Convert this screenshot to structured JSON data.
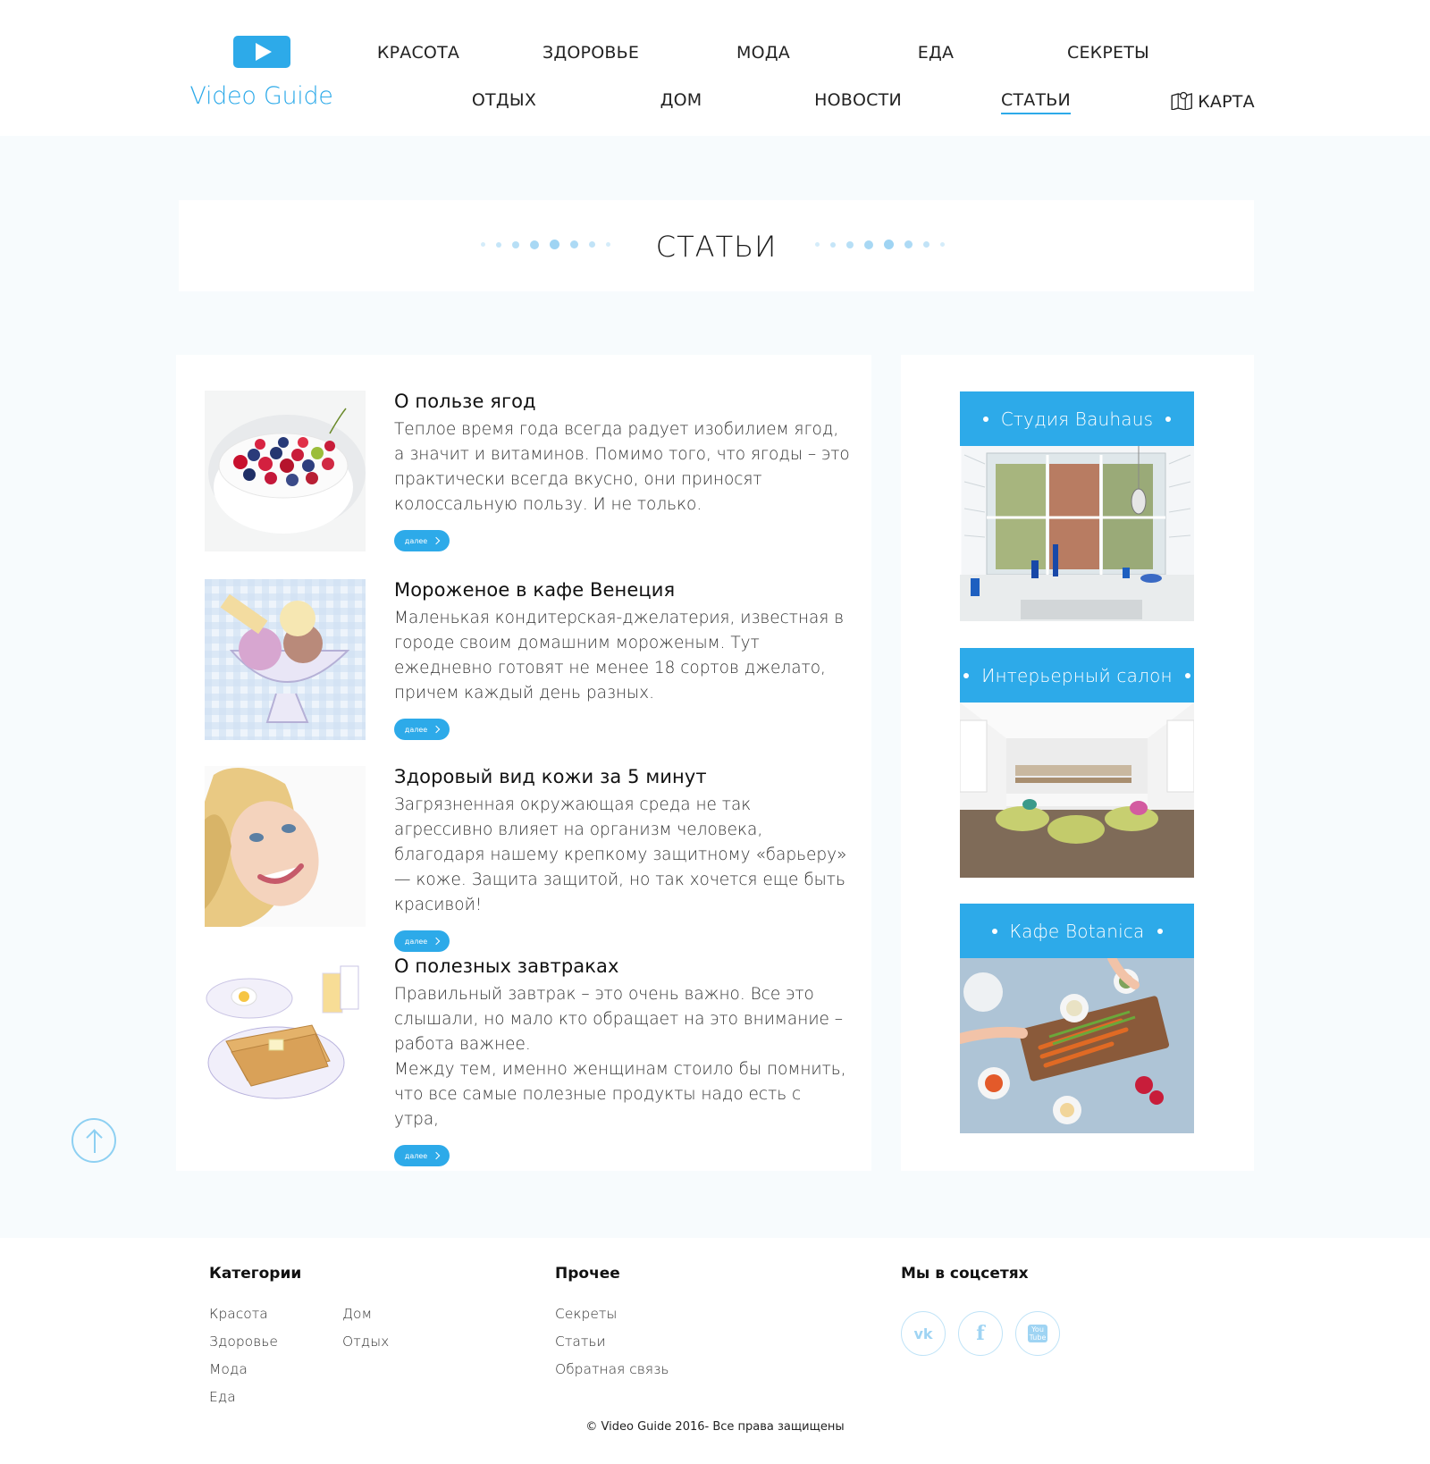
{
  "brand": {
    "name": "Video Guide"
  },
  "nav": {
    "row1": [
      "КРАСОТА",
      "ЗДОРОВЬЕ",
      "МОДА",
      "ЕДА",
      "СЕКРЕТЫ"
    ],
    "row2": [
      "ОТДЫХ",
      "ДОМ",
      "НОВОСТИ",
      "СТАТЬИ",
      "КАРТА"
    ],
    "active": "СТАТЬИ"
  },
  "page": {
    "title": "СТАТЬИ"
  },
  "articles": [
    {
      "title": "О пользе ягод",
      "text": "Теплое время года всегда радует изобилием ягод, а значит и витаминов. Помимо того, что ягоды – это практически всегда вкусно, они приносят колоссальную пользу. И не только.",
      "more": "далее",
      "image": "berries-bowl"
    },
    {
      "title": "Мороженое в кафе Венеция",
      "text": "Маленькая кондитерская-джелатерия, известная в городе своим домашним мороженым. Тут ежедневно готовят не менее 18 сортов джелато, причем каждый день разных.",
      "more": "далее",
      "image": "ice-cream-cup"
    },
    {
      "title": "Здоровый вид кожи за 5 минут",
      "text": "Загрязненная окружающая среда не так агрессивно влияет на организм человека, благодаря нашему крепкому защитному «барьеру» — коже. Защита защитой, но так хочется еще быть красивой!",
      "more": "далее",
      "image": "smiling-woman"
    },
    {
      "title": "О полезных завтраках",
      "text": "Правильный завтрак – это очень важно. Все это слышали, но мало кто обращает на это внимание – работа важнее.\nМежду тем, именно женщинам стоило бы помнить, что все самые полезные продукты надо есть с утра,",
      "more": "далее",
      "image": "breakfast-toast"
    }
  ],
  "places": [
    {
      "title": "Студия Bauhaus",
      "image": "bright-window-room"
    },
    {
      "title": "Интерьерный салон",
      "image": "loft-living-room"
    },
    {
      "title": "Кафе Botanica",
      "image": "vegetables-table"
    }
  ],
  "footer": {
    "categories_title": "Категории",
    "categories_col1": [
      "Красота",
      "Здоровье",
      "Мода",
      "Еда"
    ],
    "categories_col2": [
      "Дом",
      "Отдых"
    ],
    "other_title": "Прочее",
    "other": [
      "Секреты",
      "Статьи",
      "Обратная связь"
    ],
    "social_title": "Мы в соцсетях",
    "social": [
      {
        "label": "vk",
        "icon": "vk-icon"
      },
      {
        "label": "f",
        "icon": "facebook-icon"
      },
      {
        "label": "You Tube",
        "icon": "youtube-icon"
      }
    ],
    "copyright": "© Video Guide  2016- Все права защищены"
  },
  "colors": {
    "accent": "#2daae9",
    "background": "#f7fbfd"
  }
}
